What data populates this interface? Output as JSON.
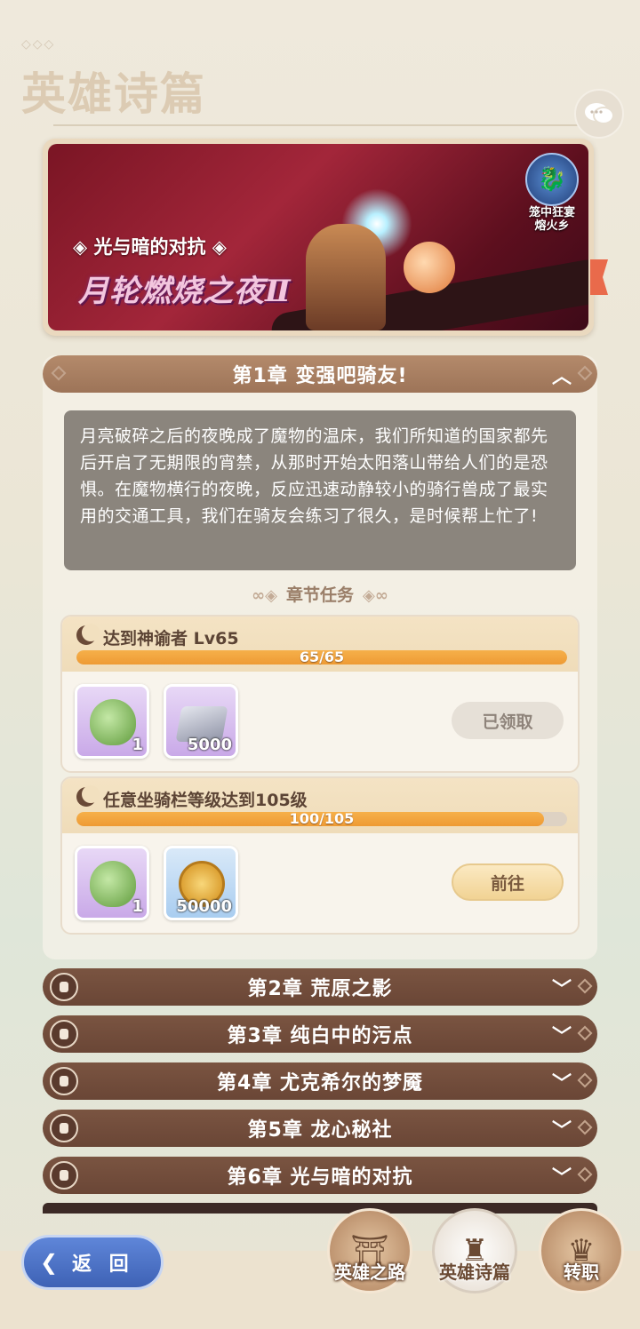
{
  "header": {
    "title": "英雄诗篇",
    "dots": "◇◇◇"
  },
  "banner": {
    "subtitle": "光与暗的对抗",
    "logo_text": "月轮燃烧之夜Ⅱ",
    "event_badge_line1": "笼中狂宴",
    "event_badge_line2": "熔火乡"
  },
  "chapter1": {
    "title": "第1章  变强吧骑友!",
    "description": "月亮破碎之后的夜晚成了魔物的温床，我们所知道的国家都先后开启了无期限的宵禁，从那时开始太阳落山带给人们的是恐惧。在魔物横行的夜晚，反应迅速动静较小的骑行兽成了最实用的交通工具，我们在骑友会练习了很久，是时候帮上忙了!",
    "section_title": "章节任务",
    "tasks": [
      {
        "title": "达到神谕者  Lv65",
        "progress_text": "65/65",
        "progress_fraction": 1.0,
        "rewards": [
          {
            "icon": "pinecone-mount-egg-icon",
            "count": "1"
          },
          {
            "icon": "silver-ingot-icon",
            "count": "5000"
          }
        ],
        "button": "已领取"
      },
      {
        "title": "任意坐骑栏等级达到105级",
        "progress_text": "100/105",
        "progress_fraction": 0.952,
        "rewards": [
          {
            "icon": "pinecone-mount-egg-icon",
            "count": "1"
          },
          {
            "icon": "gold-coin-icon",
            "count": "50000"
          }
        ],
        "button": "前往"
      }
    ]
  },
  "chapters": [
    {
      "title": "第2章  荒原之影"
    },
    {
      "title": "第3章  纯白中的污点"
    },
    {
      "title": "第4章  尤克希尔的梦魇"
    },
    {
      "title": "第5章  龙心秘社"
    },
    {
      "title": "第6章  光与暗的对抗"
    }
  ],
  "bottom_nav": {
    "back": "返 回",
    "items": [
      {
        "label": "英雄之路",
        "icon": "tower-icon",
        "active": false
      },
      {
        "label": "英雄诗篇",
        "icon": "castle-icon",
        "active": true
      },
      {
        "label": "转职",
        "icon": "crown-helmet-icon",
        "active": false
      }
    ]
  },
  "colors": {
    "chapter_bar": "#6a4636",
    "progress": "#ee9a34",
    "back_button": "#3e62b5"
  }
}
